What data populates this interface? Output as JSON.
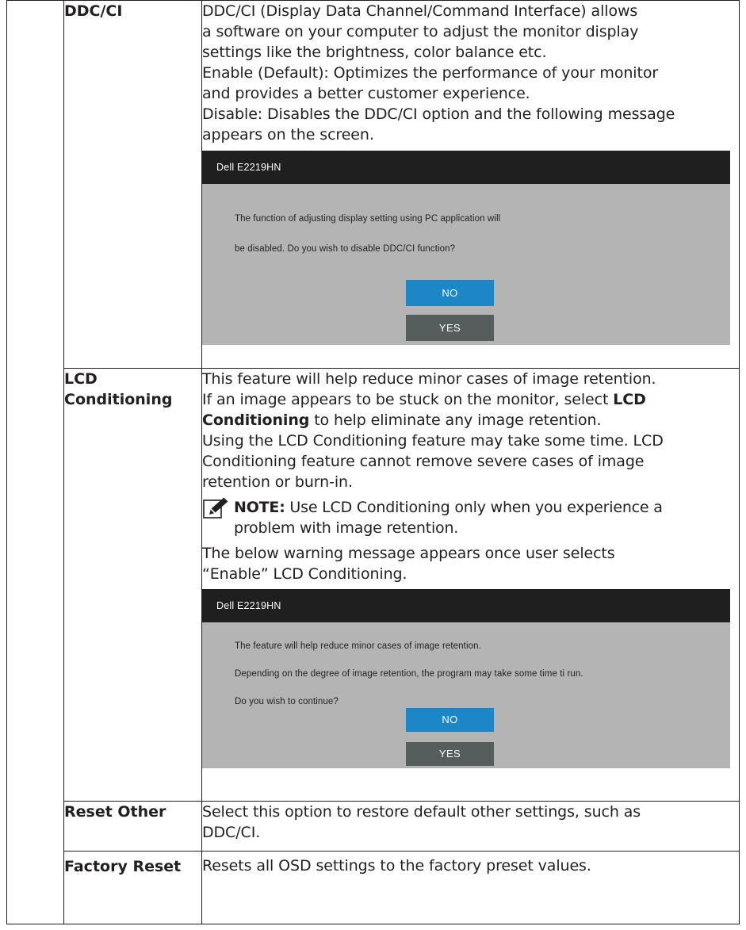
{
  "rows": [
    {
      "name": "DDC/CI",
      "lines": [
        "DDC/CI (Display Data Channel/Command Interface) allows",
        "a software on your computer to adjust the monitor display",
        "settings like the brightness, color balance etc.",
        "Enable (Default): Optimizes the performance of your monitor",
        "and provides a better customer experience.",
        "Disable: Disables the DDC/CI option and the following message",
        "appears on the screen."
      ],
      "dialog": {
        "title": "Dell  E2219HN",
        "messages": [
          "The function of adjusting display setting using PC application will",
          "be disabled. Do you wish to disable DDC/CI function?"
        ],
        "no_label": "NO",
        "yes_label": "YES"
      }
    },
    {
      "name_line1": "LCD",
      "name_line2": "Conditioning",
      "line1": "This feature will help reduce minor cases of image retention.",
      "line2_before": "If an image appears to be stuck on the monitor, select ",
      "line2_bold": "LCD",
      "line3_bold": "Conditioning",
      "line3_after": " to help eliminate any image retention.",
      "line4": "Using the LCD Conditioning feature may take some time. LCD",
      "line5": "Conditioning feature cannot remove severe cases of image",
      "line6": "retention or burn-in.",
      "note_label": "NOTE:",
      "note_line1": " Use LCD Conditioning only when you experience a",
      "note_line2": "problem with image retention.",
      "line7": "The below warning message appears once user selects",
      "line8": "“Enable” LCD Conditioning.",
      "dialog": {
        "title": "Dell  E2219HN",
        "messages": [
          "The feature will help reduce minor cases of image retention.",
          "Depending on the degree of image retention, the program may take some time ti run.",
          "Do you wish to continue?"
        ],
        "no_label": "NO",
        "yes_label": "YES"
      }
    },
    {
      "name": "Reset Other",
      "lines": [
        "Select this option to restore default other settings, such as",
        "DDC/CI."
      ]
    },
    {
      "name": "Factory Reset",
      "lines": [
        "Resets all OSD settings to the factory preset values."
      ]
    }
  ],
  "colors": {
    "button_no": "#1c86c7",
    "button_yes": "#555d5d",
    "dialog_background": "#b4b4b4",
    "dialog_titlebar": "#1f1f1f"
  },
  "icons": {
    "note": "pencil-note-icon"
  }
}
